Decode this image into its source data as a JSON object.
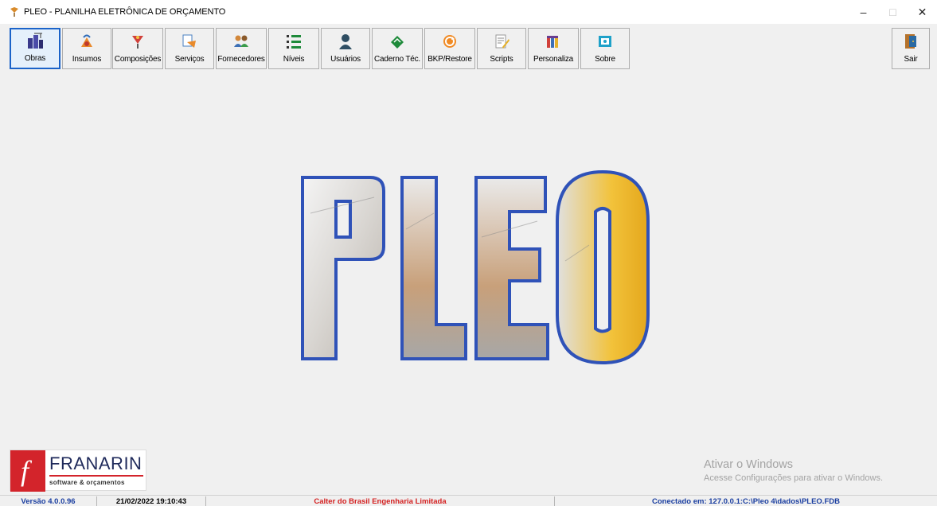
{
  "window": {
    "title": "PLEO - PLANILHA ELETRÔNICA DE ORÇAMENTO",
    "minimize_glyph": "–",
    "maximize_glyph": "□",
    "close_glyph": "✕"
  },
  "toolbar": {
    "obras": "Obras",
    "insumos": "Insumos",
    "composicoes": "Composições",
    "servicos": "Serviços",
    "fornecedores": "Fornecedores",
    "niveis": "Níveis",
    "usuarios": "Usuários",
    "caderno": "Caderno Téc.",
    "backup": "BKP/Restore",
    "scripts": "Scripts",
    "personaliza": "Personaliza",
    "sobre": "Sobre",
    "sair": "Sair",
    "active_item": "Obras",
    "icons": [
      "building-icon",
      "supplies-icon",
      "compositions-icon",
      "services-icon",
      "suppliers-icon",
      "levels-icon",
      "users-icon",
      "book-icon",
      "backup-icon",
      "scripts-icon",
      "customize-icon",
      "about-icon",
      "exit-door-icon"
    ]
  },
  "logo": {
    "text": "PLEO",
    "outline_color": "#2f52b8"
  },
  "brand": {
    "name": "FRANARIN",
    "tagline": "software & orçamentos",
    "letter": "f",
    "color": "#d3242b"
  },
  "watermark": {
    "title": "Ativar o Windows",
    "subtitle": "Acesse Configurações para ativar o Windows."
  },
  "statusbar": {
    "version": "Versão 4.0.0.96",
    "datetime": "21/02/2022  19:10:43",
    "company": "Calter do Brasil Engenharia Limitada",
    "connection": "Conectado em: 127.0.0.1:C:\\Pleo 4\\dados\\PLEO.FDB"
  }
}
